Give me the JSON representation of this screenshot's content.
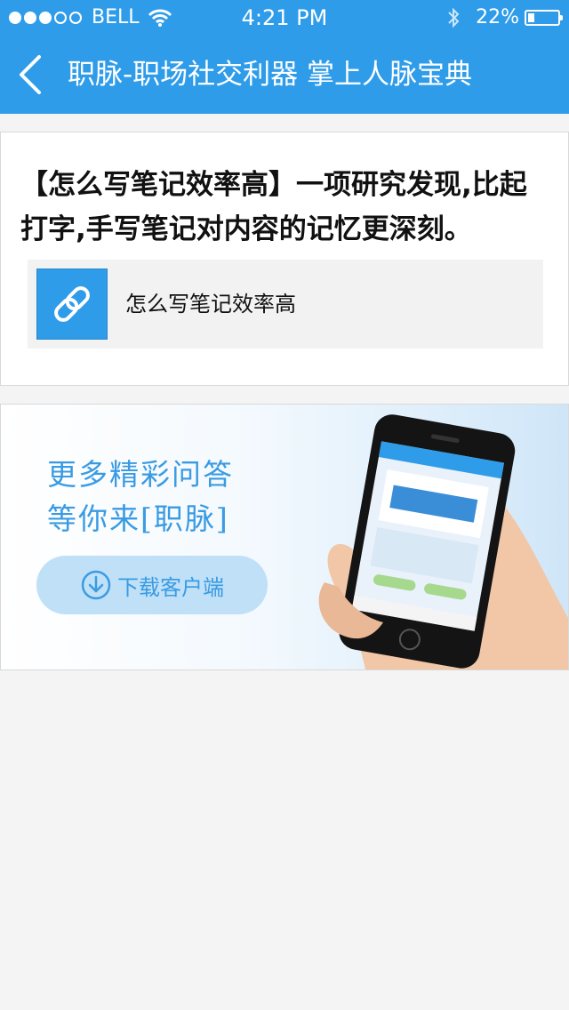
{
  "status_bar": {
    "carrier": "BELL",
    "time": "4:21 PM",
    "battery_percent": "22%",
    "battery_level": 0.22
  },
  "nav": {
    "title": "职脉-职场社交利器 掌上人脉宝典"
  },
  "article": {
    "title": "【怎么写笔记效率高】一项研究发现,比起打字,手写笔记对内容的记忆更深刻。",
    "link_text": "怎么写笔记效率高"
  },
  "banner": {
    "line1": "更多精彩问答",
    "line2": "等你来[职脉]",
    "button_label": "下载客户端"
  },
  "colors": {
    "accent": "#2f9cea",
    "banner_text": "#3a9be3",
    "background": "#f4f4f4"
  }
}
